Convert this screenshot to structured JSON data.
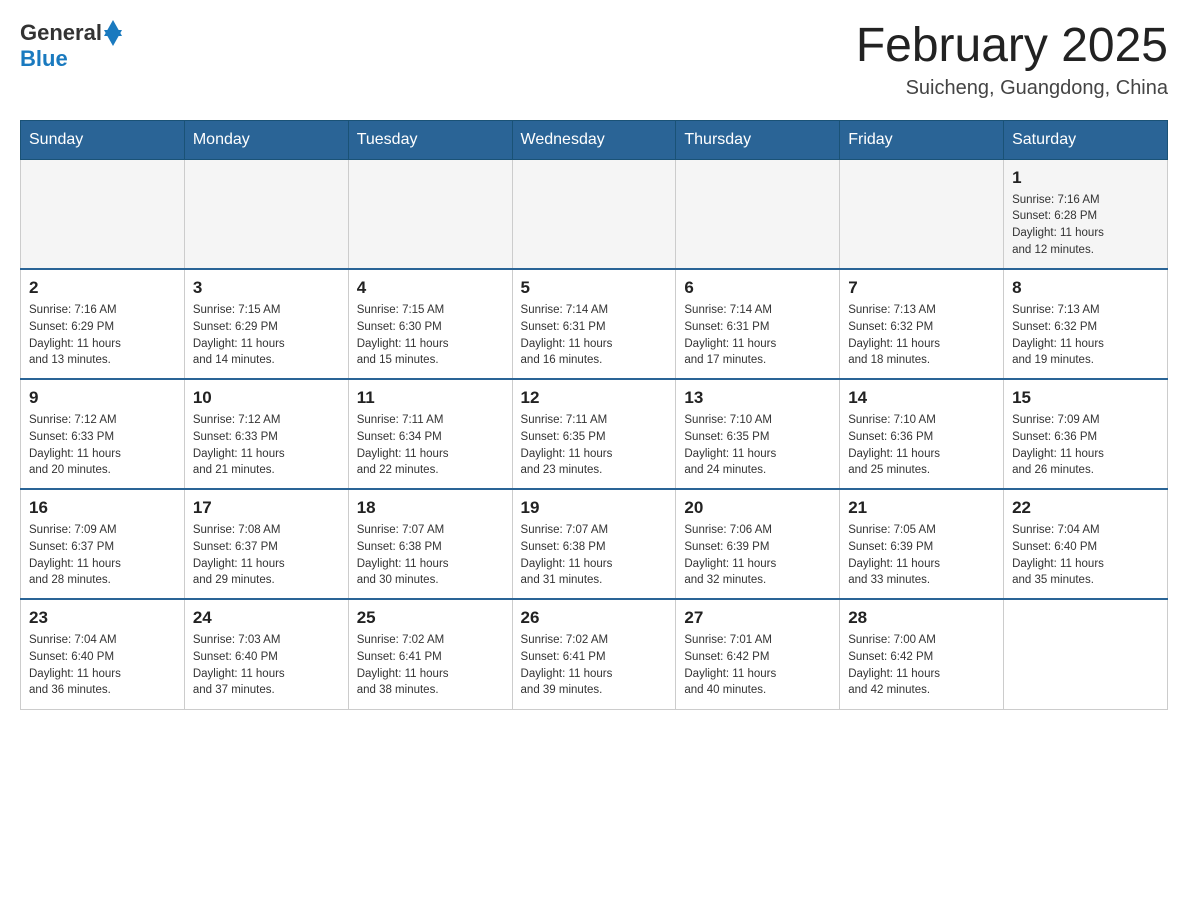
{
  "header": {
    "logo_general": "General",
    "logo_blue": "Blue",
    "month_title": "February 2025",
    "location": "Suicheng, Guangdong, China"
  },
  "weekdays": [
    "Sunday",
    "Monday",
    "Tuesday",
    "Wednesday",
    "Thursday",
    "Friday",
    "Saturday"
  ],
  "weeks": [
    {
      "days": [
        {
          "num": "",
          "info": ""
        },
        {
          "num": "",
          "info": ""
        },
        {
          "num": "",
          "info": ""
        },
        {
          "num": "",
          "info": ""
        },
        {
          "num": "",
          "info": ""
        },
        {
          "num": "",
          "info": ""
        },
        {
          "num": "1",
          "info": "Sunrise: 7:16 AM\nSunset: 6:28 PM\nDaylight: 11 hours\nand 12 minutes."
        }
      ]
    },
    {
      "days": [
        {
          "num": "2",
          "info": "Sunrise: 7:16 AM\nSunset: 6:29 PM\nDaylight: 11 hours\nand 13 minutes."
        },
        {
          "num": "3",
          "info": "Sunrise: 7:15 AM\nSunset: 6:29 PM\nDaylight: 11 hours\nand 14 minutes."
        },
        {
          "num": "4",
          "info": "Sunrise: 7:15 AM\nSunset: 6:30 PM\nDaylight: 11 hours\nand 15 minutes."
        },
        {
          "num": "5",
          "info": "Sunrise: 7:14 AM\nSunset: 6:31 PM\nDaylight: 11 hours\nand 16 minutes."
        },
        {
          "num": "6",
          "info": "Sunrise: 7:14 AM\nSunset: 6:31 PM\nDaylight: 11 hours\nand 17 minutes."
        },
        {
          "num": "7",
          "info": "Sunrise: 7:13 AM\nSunset: 6:32 PM\nDaylight: 11 hours\nand 18 minutes."
        },
        {
          "num": "8",
          "info": "Sunrise: 7:13 AM\nSunset: 6:32 PM\nDaylight: 11 hours\nand 19 minutes."
        }
      ]
    },
    {
      "days": [
        {
          "num": "9",
          "info": "Sunrise: 7:12 AM\nSunset: 6:33 PM\nDaylight: 11 hours\nand 20 minutes."
        },
        {
          "num": "10",
          "info": "Sunrise: 7:12 AM\nSunset: 6:33 PM\nDaylight: 11 hours\nand 21 minutes."
        },
        {
          "num": "11",
          "info": "Sunrise: 7:11 AM\nSunset: 6:34 PM\nDaylight: 11 hours\nand 22 minutes."
        },
        {
          "num": "12",
          "info": "Sunrise: 7:11 AM\nSunset: 6:35 PM\nDaylight: 11 hours\nand 23 minutes."
        },
        {
          "num": "13",
          "info": "Sunrise: 7:10 AM\nSunset: 6:35 PM\nDaylight: 11 hours\nand 24 minutes."
        },
        {
          "num": "14",
          "info": "Sunrise: 7:10 AM\nSunset: 6:36 PM\nDaylight: 11 hours\nand 25 minutes."
        },
        {
          "num": "15",
          "info": "Sunrise: 7:09 AM\nSunset: 6:36 PM\nDaylight: 11 hours\nand 26 minutes."
        }
      ]
    },
    {
      "days": [
        {
          "num": "16",
          "info": "Sunrise: 7:09 AM\nSunset: 6:37 PM\nDaylight: 11 hours\nand 28 minutes."
        },
        {
          "num": "17",
          "info": "Sunrise: 7:08 AM\nSunset: 6:37 PM\nDaylight: 11 hours\nand 29 minutes."
        },
        {
          "num": "18",
          "info": "Sunrise: 7:07 AM\nSunset: 6:38 PM\nDaylight: 11 hours\nand 30 minutes."
        },
        {
          "num": "19",
          "info": "Sunrise: 7:07 AM\nSunset: 6:38 PM\nDaylight: 11 hours\nand 31 minutes."
        },
        {
          "num": "20",
          "info": "Sunrise: 7:06 AM\nSunset: 6:39 PM\nDaylight: 11 hours\nand 32 minutes."
        },
        {
          "num": "21",
          "info": "Sunrise: 7:05 AM\nSunset: 6:39 PM\nDaylight: 11 hours\nand 33 minutes."
        },
        {
          "num": "22",
          "info": "Sunrise: 7:04 AM\nSunset: 6:40 PM\nDaylight: 11 hours\nand 35 minutes."
        }
      ]
    },
    {
      "days": [
        {
          "num": "23",
          "info": "Sunrise: 7:04 AM\nSunset: 6:40 PM\nDaylight: 11 hours\nand 36 minutes."
        },
        {
          "num": "24",
          "info": "Sunrise: 7:03 AM\nSunset: 6:40 PM\nDaylight: 11 hours\nand 37 minutes."
        },
        {
          "num": "25",
          "info": "Sunrise: 7:02 AM\nSunset: 6:41 PM\nDaylight: 11 hours\nand 38 minutes."
        },
        {
          "num": "26",
          "info": "Sunrise: 7:02 AM\nSunset: 6:41 PM\nDaylight: 11 hours\nand 39 minutes."
        },
        {
          "num": "27",
          "info": "Sunrise: 7:01 AM\nSunset: 6:42 PM\nDaylight: 11 hours\nand 40 minutes."
        },
        {
          "num": "28",
          "info": "Sunrise: 7:00 AM\nSunset: 6:42 PM\nDaylight: 11 hours\nand 42 minutes."
        },
        {
          "num": "",
          "info": ""
        }
      ]
    }
  ]
}
